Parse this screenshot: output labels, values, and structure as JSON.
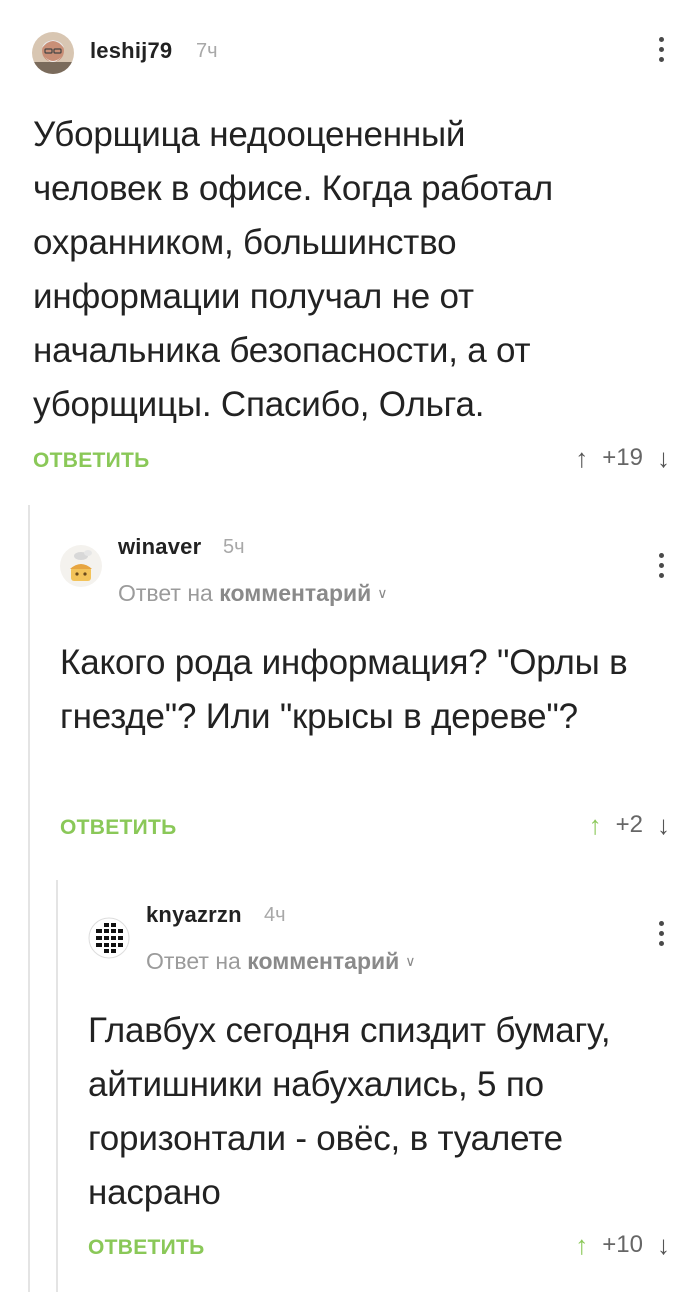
{
  "comments": [
    {
      "username": "leshij79",
      "time": "7ч",
      "text": "Уборщица недооцененный человек в офисе. Когда работал охранником, большинство информации получал не от начальника безопасности, а от уборщицы. Спасибо, Ольга.",
      "reply_label": "ОТВЕТИТЬ",
      "rating": "+19",
      "upvote_icon": "arrow-up-icon",
      "downvote_icon": "arrow-down-icon"
    },
    {
      "username": "winaver",
      "time": "5ч",
      "reply_to_prefix": "Ответ на",
      "reply_to_link": "комментарий",
      "text": "Какого рода информация? \"Орлы в гнезде\"? Или \"крысы в дереве\"?",
      "reply_label": "ОТВЕТИТЬ",
      "rating": "+2",
      "upvoted": true
    },
    {
      "username": "knyazrzn",
      "time": "4ч",
      "reply_to_prefix": "Ответ на",
      "reply_to_link": "комментарий",
      "text": "Главбух сегодня спиздит бумагу, айтишники набухались, 5 по горизонтали - овёс, в туалете насрано",
      "reply_label": "ОТВЕТИТЬ",
      "rating": "+10",
      "upvoted": true
    }
  ],
  "colors": {
    "accent": "#8ac858",
    "text": "#222222",
    "muted": "#a8a8a8",
    "thread_line": "#e4e4e4"
  }
}
